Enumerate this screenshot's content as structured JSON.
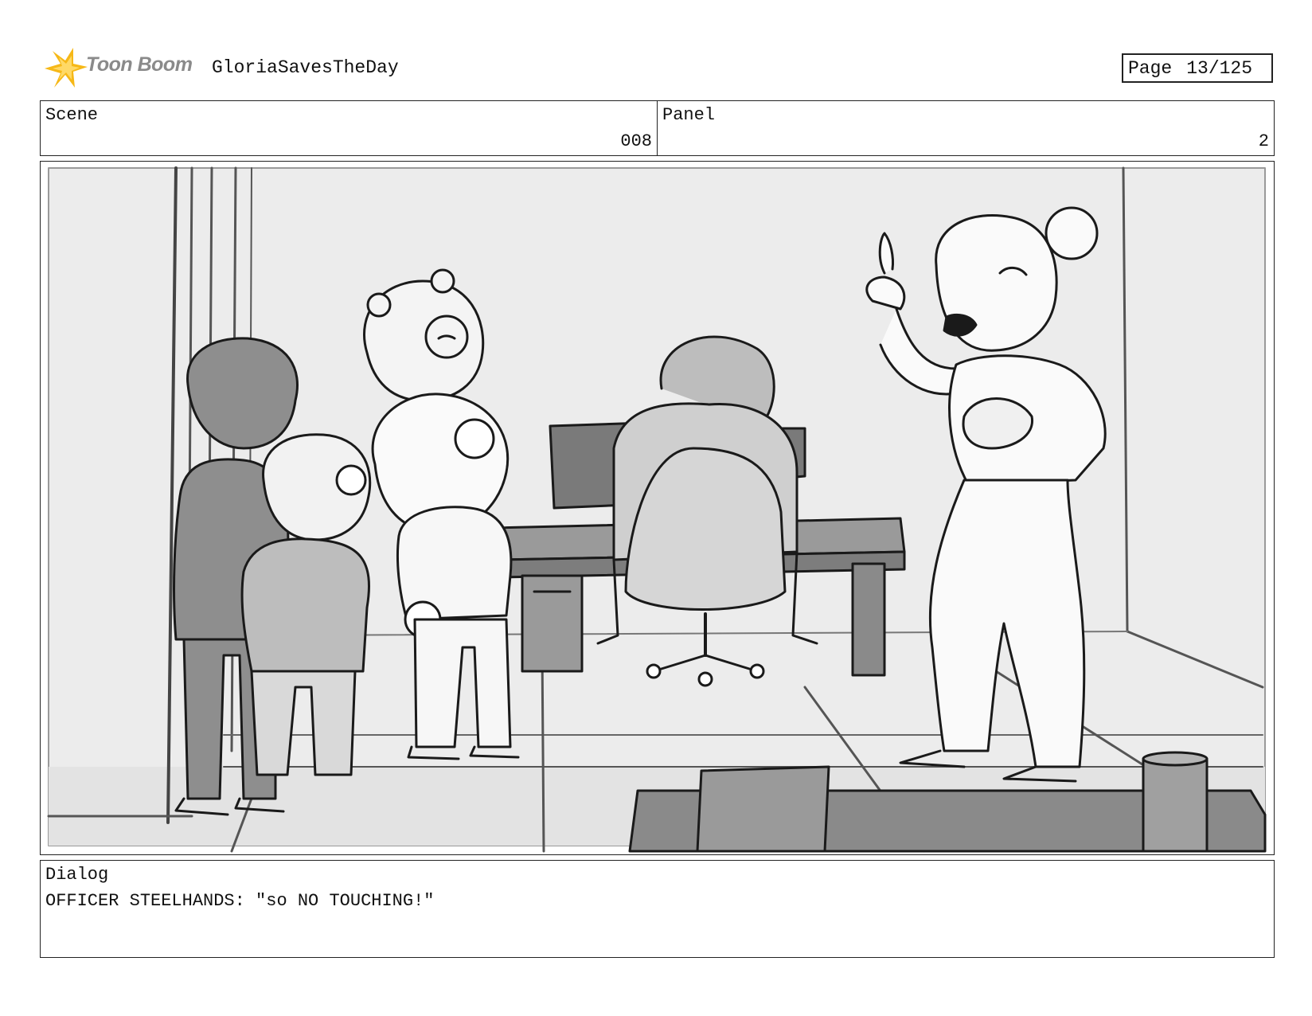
{
  "header": {
    "logo_text": "Toon Boom",
    "project_title": "GloriaSavesTheDay",
    "page_label": "Page",
    "page_number": "13/125"
  },
  "info": {
    "scene_label": "Scene",
    "scene_value": "008",
    "panel_label": "Panel",
    "panel_value": "2"
  },
  "dialog": {
    "label": "Dialog",
    "text": "OFFICER STEELHANDS: \"so NO TOUCHING!\""
  },
  "colors": {
    "logo_star": "#f6b817",
    "logo_text": "#8a8a8a",
    "sketch_dark": "#8e8e8e",
    "sketch_mid": "#bdbdbd",
    "sketch_light": "#d9d9d9",
    "panel_bg": "#ececec"
  }
}
